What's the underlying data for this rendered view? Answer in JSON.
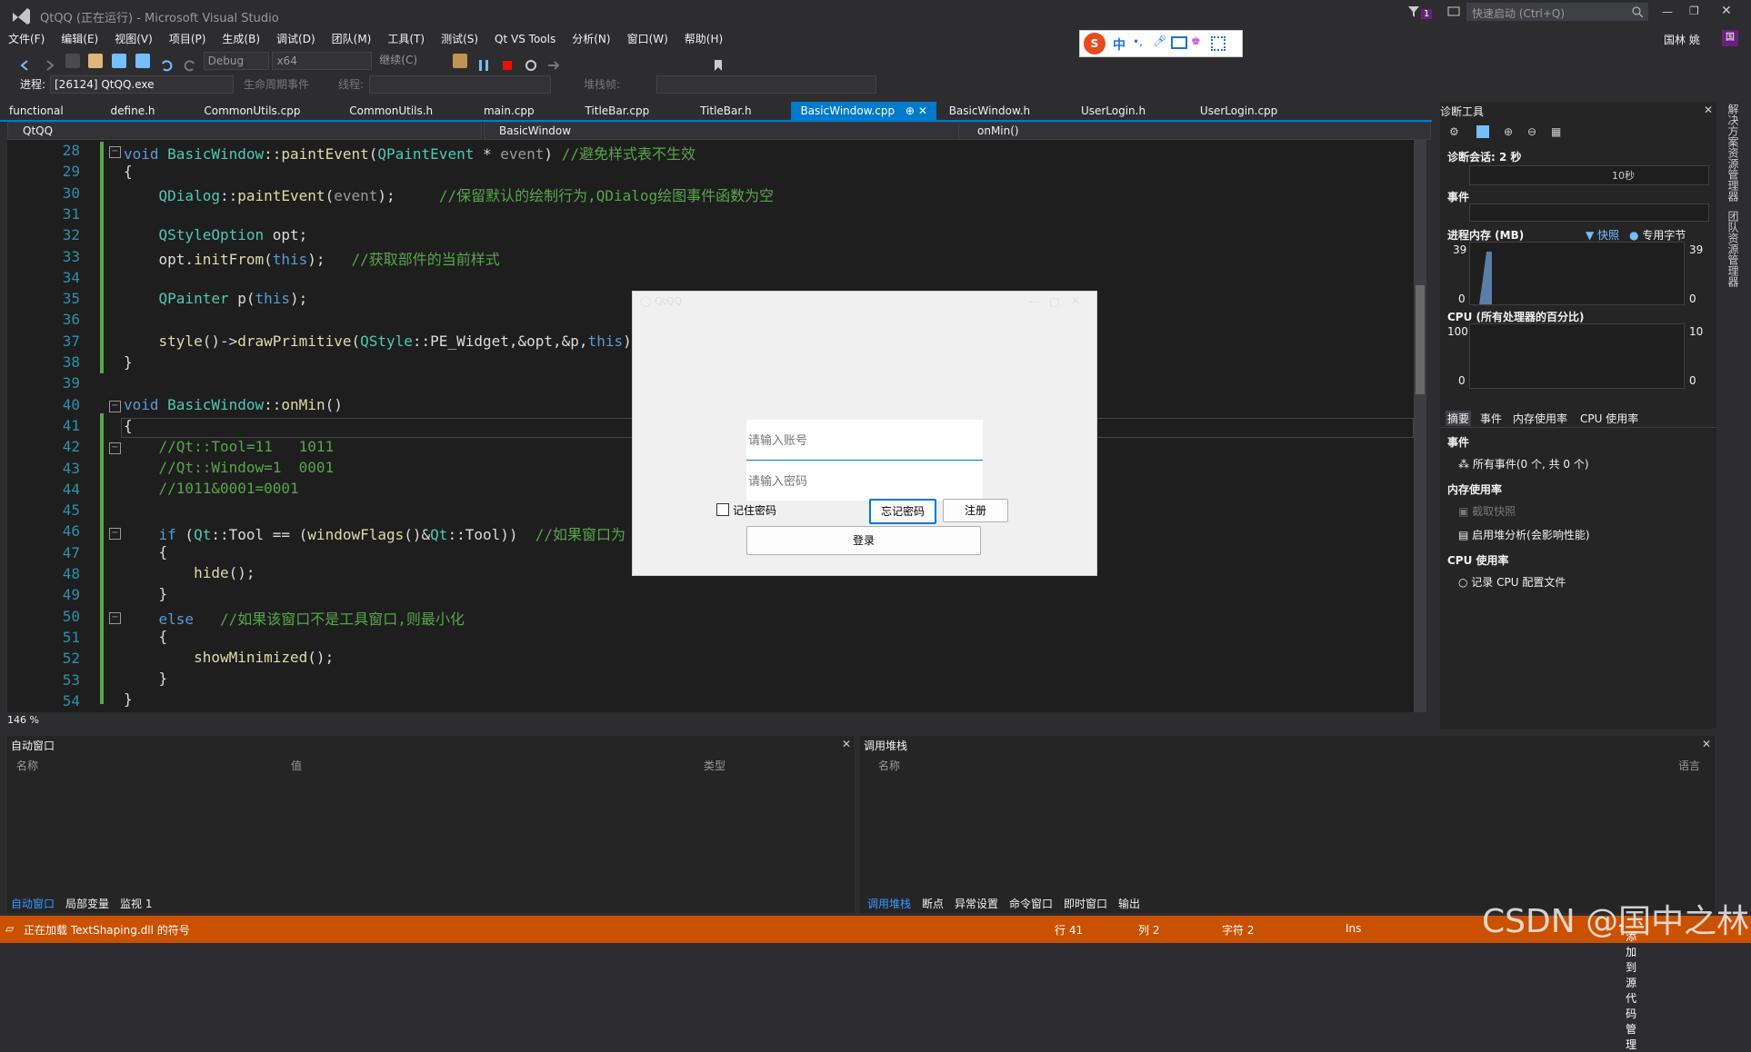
{
  "window": {
    "title": "QtQQ (正在运行) - Microsoft Visual Studio",
    "quick_launch": "快速启动 (Ctrl+Q)",
    "user": "国林 姚",
    "user_initial": "国",
    "notify_count": "1"
  },
  "menu": [
    "文件(F)",
    "编辑(E)",
    "视图(V)",
    "项目(P)",
    "生成(B)",
    "调试(D)",
    "团队(M)",
    "工具(T)",
    "测试(S)",
    "Qt VS Tools",
    "分析(N)",
    "窗口(W)",
    "帮助(H)"
  ],
  "toolbar": {
    "config": "Debug",
    "platform": "x64",
    "continue": "继续(C)",
    "process_label": "进程:",
    "process": "[26124] QtQQ.exe",
    "lifecycle": "生命周期事件",
    "thread_label": "线程:",
    "stack_label": "堆栈帧:"
  },
  "ime": {
    "lang": "中"
  },
  "tabs": [
    {
      "label": "functional"
    },
    {
      "label": "define.h"
    },
    {
      "label": "CommonUtils.cpp"
    },
    {
      "label": "CommonUtils.h"
    },
    {
      "label": "main.cpp"
    },
    {
      "label": "TitleBar.cpp"
    },
    {
      "label": "TitleBar.h"
    },
    {
      "label": "BasicWindow.cpp",
      "active": true
    },
    {
      "label": "BasicWindow.h"
    },
    {
      "label": "UserLogin.h"
    },
    {
      "label": "UserLogin.cpp"
    }
  ],
  "nav": {
    "project": "QtQQ",
    "class": "BasicWindow",
    "member": "onMin()"
  },
  "editor": {
    "line_numbers": [
      "28",
      "29",
      "30",
      "31",
      "32",
      "33",
      "34",
      "35",
      "36",
      "37",
      "38",
      "39",
      "40",
      "41",
      "42",
      "43",
      "44",
      "45",
      "46",
      "47",
      "48",
      "49",
      "50",
      "51",
      "52",
      "53",
      "54"
    ],
    "zoom": "146 %"
  },
  "diagnostics": {
    "title": "诊断工具",
    "session": "诊断会话: 2 秒",
    "timeline_tick": "10秒",
    "events_label": "事件",
    "memory_label": "进程内存 (MB)",
    "snapshot_legend": "快照",
    "private_bytes_legend": "专用字节",
    "mem_max": "39",
    "mem_min": "0",
    "cpu_label": "CPU (所有处理器的百分比)",
    "cpu_max": "100",
    "cpu_min": "0",
    "cpu_right_max": "10",
    "tabs": [
      "摘要",
      "事件",
      "内存使用率",
      "CPU 使用率"
    ],
    "events_section": "事件",
    "all_events": "所有事件(0 个, 共 0 个)",
    "memory_section": "内存使用率",
    "take_snapshot": "截取快照",
    "heap_profile": "启用堆分析(会影响性能)",
    "cpu_section": "CPU 使用率",
    "record_cpu": "记录 CPU 配置文件",
    "side_tabs": [
      "解决方案资源管理器",
      "团队资源管理器"
    ]
  },
  "autos": {
    "title": "自动窗口",
    "cols": [
      "名称",
      "值",
      "类型"
    ],
    "tabs": [
      "自动窗口",
      "局部变量",
      "监视 1"
    ]
  },
  "callstack": {
    "title": "调用堆栈",
    "cols": [
      "名称",
      "语言"
    ],
    "tabs": [
      "调用堆栈",
      "断点",
      "异常设置",
      "命令窗口",
      "即时窗口",
      "输出"
    ]
  },
  "status": {
    "message": "正在加载 TextShaping.dll 的符号",
    "line": "行 41",
    "col": "列 2",
    "char": "字符 2",
    "mode": "Ins",
    "source_control": "添加到源代码管理"
  },
  "login_dialog": {
    "title": "QtQQ",
    "account_placeholder": "请输入账号",
    "password_placeholder": "请输入密码",
    "remember": "记住密码",
    "forgot": "忘记密码",
    "register": "注册",
    "login": "登录"
  },
  "watermark": "CSDN @国中之林"
}
